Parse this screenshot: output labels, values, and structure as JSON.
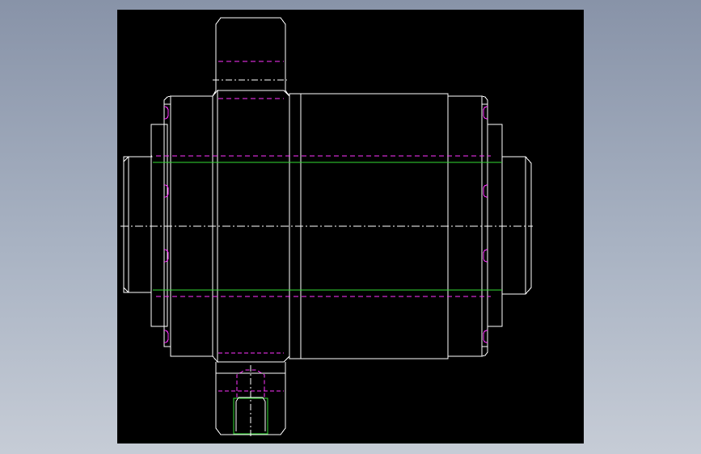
{
  "window": {
    "background_top": "#8893a8",
    "background_bottom": "#c6ccd6"
  },
  "drawing": {
    "background": "#000000",
    "colors": {
      "outline": "#ffffff",
      "hidden": "#ff33ff",
      "thread": "#33dd33",
      "center": "#ffffff"
    },
    "parts": [
      "outer-housing",
      "left-flange",
      "right-flange",
      "left-end-cap",
      "right-end-cap",
      "top-port",
      "bottom-port",
      "center-sleeve",
      "bores",
      "center-axis"
    ]
  }
}
